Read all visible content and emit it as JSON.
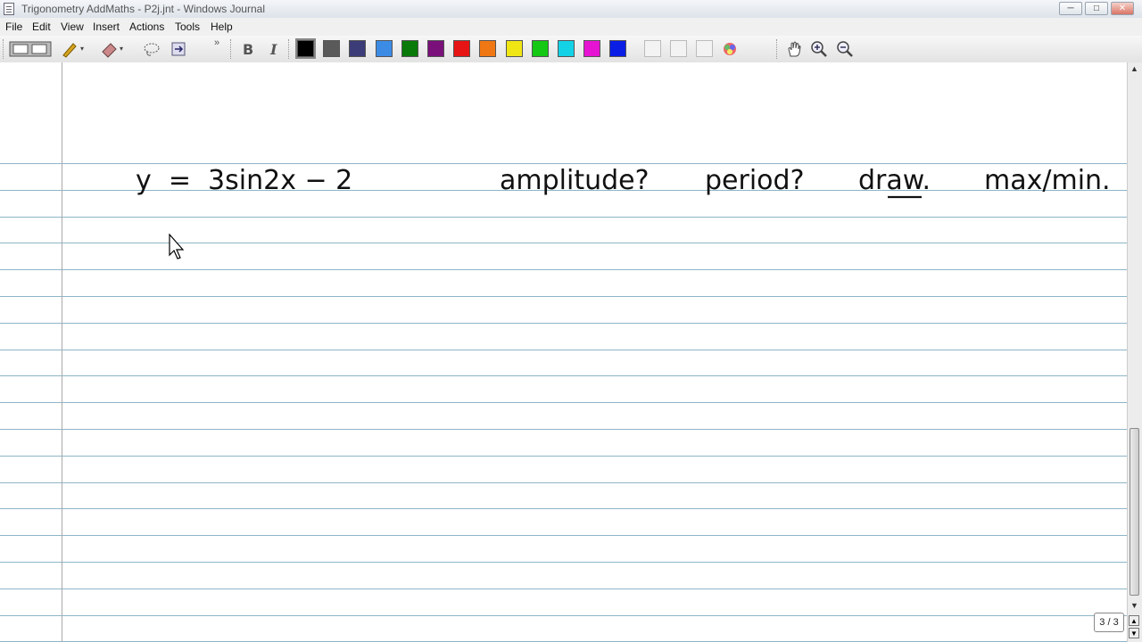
{
  "window": {
    "title": "Trigonometry AddMaths - P2j.jnt - Windows Journal",
    "minimize": "─",
    "maximize": "□",
    "close": "✕"
  },
  "menu": [
    "File",
    "Edit",
    "View",
    "Insert",
    "Actions",
    "Tools",
    "Help"
  ],
  "toolbar": {
    "icons": [
      "pen-tool-icon",
      "highlighter-icon",
      "eraser-icon",
      "lasso-select-icon",
      "insert-space-icon",
      "bold-ink-icon",
      "italic-ink-icon"
    ],
    "pen_colors": [
      "#000000",
      "#5a5a5a",
      "#3c3c78",
      "#3c8ce6",
      "#0a7a0a",
      "#7a107a",
      "#e61414",
      "#f07814",
      "#f0e614",
      "#14c814",
      "#14d2e6",
      "#e614d2",
      "#0a1ee6"
    ],
    "view_tools": [
      "pan-hand-icon",
      "zoom-in-icon",
      "zoom-out-icon"
    ],
    "overflow": "»"
  },
  "note": {
    "handwritten_line": {
      "equation": "y  =  3sin2x − 2",
      "q1": "amplitude?",
      "q2": "period?",
      "q3": "draw.",
      "q4": "max/min."
    }
  },
  "status": {
    "page_indicator": "3 / 3"
  }
}
